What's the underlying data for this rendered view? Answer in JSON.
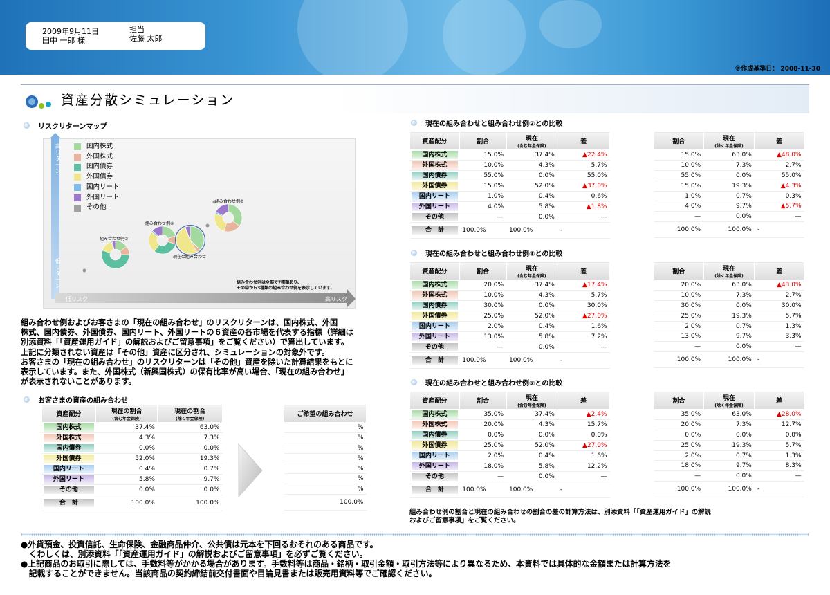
{
  "header": {
    "date": "2009年9月11日",
    "customer": "田中 一郎 様",
    "staff_label": "担当",
    "staff_name": "佐藤 太郎",
    "as_of": "※作成基準日： 2008-11-30"
  },
  "title": "資産分散シミュレーション",
  "risk_map": {
    "section_title": "リスクリターンマップ",
    "y_high": "高リターン",
    "y_low": "低リターン",
    "x_low": "低リスク",
    "x_high": "高リスク",
    "legend": [
      {
        "label": "国内株式",
        "color": "#a3d99e"
      },
      {
        "label": "外国株式",
        "color": "#e8b49c"
      },
      {
        "label": "国内債券",
        "color": "#5cbf9f"
      },
      {
        "label": "外国債券",
        "color": "#f0e68c"
      },
      {
        "label": "国内リート",
        "color": "#7fbde8"
      },
      {
        "label": "外国リート",
        "color": "#9c78cc"
      },
      {
        "label": "その他",
        "color": "#a0a0a0"
      }
    ],
    "pie_labels": {
      "p2": "組み合わせ例②",
      "p4": "組み合わせ例④",
      "cur": "現在の組み合わせ",
      "p7": "組み合わせ例⑦"
    },
    "note_line1": "組み合わせ例は全部で7種類あり、",
    "note_line2": "その中から3種類の組み合わせ例を表示しています。"
  },
  "paragraph": [
    "組み合わせ例およびお客さまの「現在の組み合わせ」のリスクリターンは、国内株式、外国",
    "株式、国内債券、外国債券、国内リート、外国リートの６資産の各市場を代表する指標（詳細は",
    "別添資料「「資産運用ガイド」の解説およびご留意事項」をご覧ください）で算出しています。",
    "上記に分類されない資産は「その他」資産に区分され、シミュレーションの対象外です。",
    "お客さまの「現在の組み合わせ」のリスクリターンは「その他」資産を除いた計算結果をもとに",
    "表示しています。また、外国株式（新興国株式）の保有比率が高い場合、「現在の組み合わせ」",
    "が表示されないことがあります。"
  ],
  "customer_table": {
    "section_title": "お客さまの資産の組み合わせ",
    "h_asset": "資産配分",
    "h_cur_incl": "現在の割合",
    "h_cur_incl_sub": "(含む年金保険)",
    "h_cur_excl": "現在の割合",
    "h_cur_excl_sub": "(除く年金保険)",
    "h_wish": "ご希望の組み合わせ",
    "rows": [
      {
        "label": "国内株式",
        "a": "37.4%",
        "b": "63.0%",
        "c": "%"
      },
      {
        "label": "外国株式",
        "a": "4.3%",
        "b": "7.3%",
        "c": "%"
      },
      {
        "label": "国内債券",
        "a": "0.0%",
        "b": "0.0%",
        "c": "%"
      },
      {
        "label": "外国債券",
        "a": "52.0%",
        "b": "19.3%",
        "c": "%"
      },
      {
        "label": "国内リート",
        "a": "0.4%",
        "b": "0.7%",
        "c": "%"
      },
      {
        "label": "外国リート",
        "a": "5.8%",
        "b": "9.7%",
        "c": "%"
      },
      {
        "label": "その他",
        "a": "0.0%",
        "b": "0.0%",
        "c": "%"
      },
      {
        "label": "合　計",
        "a": "100.0%",
        "b": "100.0%",
        "c": "100.0%"
      }
    ]
  },
  "comparisons": [
    {
      "title": "現在の組み合わせと組み合わせ例②との比較",
      "rows": [
        [
          "国内株式",
          "15.0%",
          "37.4%",
          "▲22.4%",
          "15.0%",
          "63.0%",
          "▲48.0%"
        ],
        [
          "外国株式",
          "10.0%",
          "4.3%",
          "5.7%",
          "10.0%",
          "7.3%",
          "2.7%"
        ],
        [
          "国内債券",
          "55.0%",
          "0.0%",
          "55.0%",
          "55.0%",
          "0.0%",
          "55.0%"
        ],
        [
          "外国債券",
          "15.0%",
          "52.0%",
          "▲37.0%",
          "15.0%",
          "19.3%",
          "▲4.3%"
        ],
        [
          "国内リート",
          "1.0%",
          "0.4%",
          "0.6%",
          "1.0%",
          "0.7%",
          "0.3%"
        ],
        [
          "外国リート",
          "4.0%",
          "5.8%",
          "▲1.8%",
          "4.0%",
          "9.7%",
          "▲5.7%"
        ],
        [
          "その他",
          "—",
          "0.0%",
          "—",
          "—",
          "0.0%",
          "—"
        ],
        [
          "合　計",
          "100.0%",
          "100.0%",
          "-",
          "100.0%",
          "100.0%",
          "-"
        ]
      ]
    },
    {
      "title": "現在の組み合わせと組み合わせ例④との比較",
      "rows": [
        [
          "国内株式",
          "20.0%",
          "37.4%",
          "▲17.4%",
          "20.0%",
          "63.0%",
          "▲43.0%"
        ],
        [
          "外国株式",
          "10.0%",
          "4.3%",
          "5.7%",
          "10.0%",
          "7.3%",
          "2.7%"
        ],
        [
          "国内債券",
          "30.0%",
          "0.0%",
          "30.0%",
          "30.0%",
          "0.0%",
          "30.0%"
        ],
        [
          "外国債券",
          "25.0%",
          "52.0%",
          "▲27.0%",
          "25.0%",
          "19.3%",
          "5.7%"
        ],
        [
          "国内リート",
          "2.0%",
          "0.4%",
          "1.6%",
          "2.0%",
          "0.7%",
          "1.3%"
        ],
        [
          "外国リート",
          "13.0%",
          "5.8%",
          "7.2%",
          "13.0%",
          "9.7%",
          "3.3%"
        ],
        [
          "その他",
          "—",
          "0.0%",
          "—",
          "—",
          "0.0%",
          "—"
        ],
        [
          "合　計",
          "100.0%",
          "100.0%",
          "-",
          "100.0%",
          "100.0%",
          "-"
        ]
      ]
    },
    {
      "title": "現在の組み合わせと組み合わせ例⑦との比較",
      "rows": [
        [
          "国内株式",
          "35.0%",
          "37.4%",
          "▲2.4%",
          "35.0%",
          "63.0%",
          "▲28.0%"
        ],
        [
          "外国株式",
          "20.0%",
          "4.3%",
          "15.7%",
          "20.0%",
          "7.3%",
          "12.7%"
        ],
        [
          "国内債券",
          "0.0%",
          "0.0%",
          "0.0%",
          "0.0%",
          "0.0%",
          "0.0%"
        ],
        [
          "外国債券",
          "25.0%",
          "52.0%",
          "▲27.0%",
          "25.0%",
          "19.3%",
          "5.7%"
        ],
        [
          "国内リート",
          "2.0%",
          "0.4%",
          "1.6%",
          "2.0%",
          "0.7%",
          "1.3%"
        ],
        [
          "外国リート",
          "18.0%",
          "5.8%",
          "12.2%",
          "18.0%",
          "9.7%",
          "8.3%"
        ],
        [
          "その他",
          "—",
          "0.0%",
          "—",
          "—",
          "0.0%",
          "—"
        ],
        [
          "合　計",
          "100.0%",
          "100.0%",
          "-",
          "100.0%",
          "100.0%",
          "-"
        ]
      ]
    }
  ],
  "comp_headers": {
    "asset": "資産配分",
    "ratio": "割合",
    "cur": "現在",
    "cur_sub_incl": "(含む年金保険)",
    "cur_sub_excl": "(除く年金保険)",
    "diff": "差"
  },
  "calc_note": [
    "組み合わせ例の割合と現在の組み合わせの割合の差の計算方法は、別添資料「「資産運用ガイド」の解説",
    "およびご留意事項」をご覧ください。"
  ],
  "footer": [
    "●外貨預金、投資信託、生命保険、金融商品仲介、公共債は元本を下回るおそれのある商品です。",
    "　くわしくは、別添資料「「資産運用ガイド」の解説およびご留意事項」を必ずご覧ください。",
    "●上記商品のお取引に際しては、手数料等がかかる場合があります。手数料等は商品・銘柄・取引金額・取引方法等により異なるため、本資料では具体的な金額または計算方法を",
    "　記載することができません。当該商品の契約締結前交付書面や目論見書または販売用資料等でご確認ください。"
  ]
}
